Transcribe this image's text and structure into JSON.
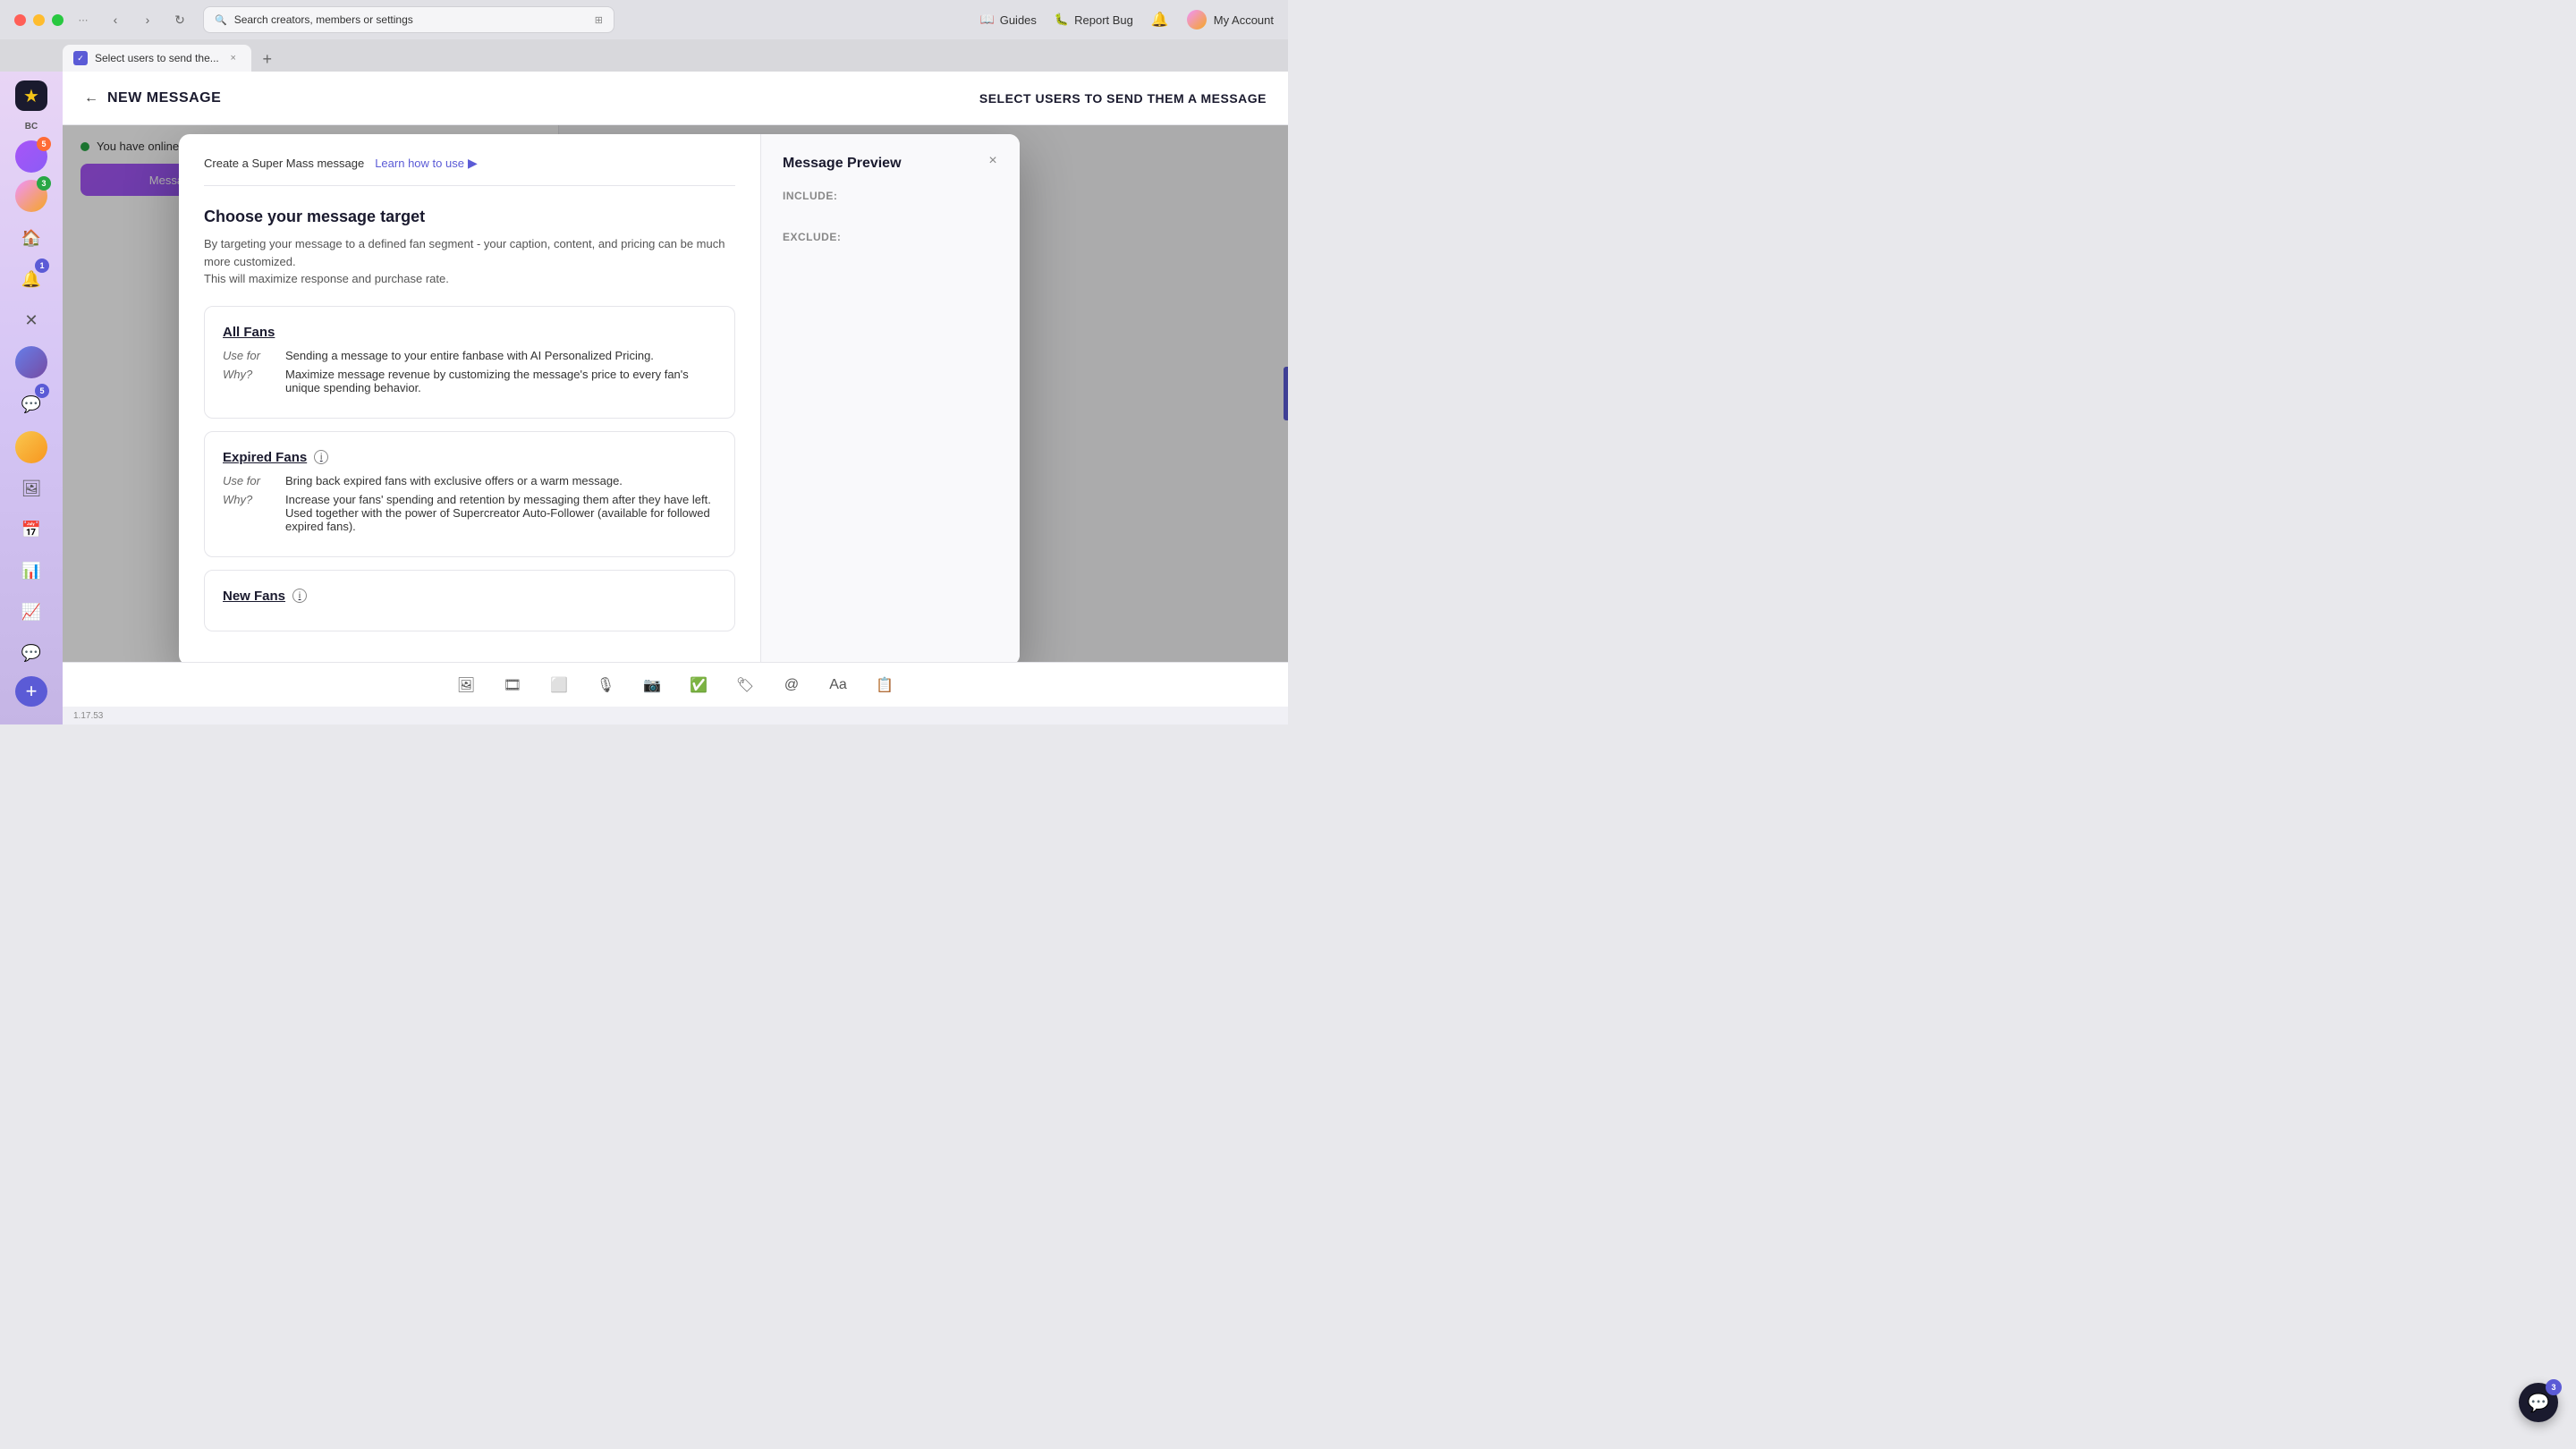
{
  "browser": {
    "search_placeholder": "Search creators, members or settings",
    "tab_title": "Select users to send the...",
    "guides_label": "Guides",
    "report_bug_label": "Report Bug",
    "my_account_label": "My Account"
  },
  "page": {
    "back_label": "←",
    "title": "NEW MESSAGE",
    "subtitle": "SELECT USERS TO SEND THEM A MESSAGE"
  },
  "sidebar": {
    "logo": "★",
    "bc_label": "BC",
    "add_label": "+",
    "badge_5": "5",
    "badge_3": "3",
    "badge_1": "1"
  },
  "banner": {
    "online_text": "You have online fans. Message them now:",
    "button_label": "Message Online Fans"
  },
  "modal": {
    "header_label": "Create a Super Mass message",
    "learn_link": "Learn how to use",
    "learn_icon": "▶",
    "close_icon": "×",
    "section_title": "Choose your message target",
    "section_desc_1": "By targeting your message to a defined fan segment - your caption, content, and pricing can be much more customized.",
    "section_desc_2": "This will maximize response and purchase rate.",
    "cards": [
      {
        "title": "All Fans",
        "use_for_label": "Use for",
        "use_for_value": "Sending a message to your entire fanbase with AI Personalized Pricing.",
        "why_label": "Why?",
        "why_value": "Maximize message revenue by customizing the message's price to every fan's unique spending behavior."
      },
      {
        "title": "Expired Fans",
        "has_info": true,
        "use_for_label": "Use for",
        "use_for_value": "Bring back expired fans with exclusive offers or a warm message.",
        "why_label": "Why?",
        "why_value_1": "Increase your fans' spending and retention by messaging them after they have left.",
        "why_value_2": "Used together with the power of Supercreator Auto-Follower (available for followed expired fans)."
      },
      {
        "title": "New Fans",
        "has_info": true
      }
    ],
    "preview": {
      "title": "Message Preview",
      "include_label": "INCLUDE:",
      "exclude_label": "EXCLUDE:"
    }
  },
  "toolbar": {
    "icons": [
      "🖼",
      "🎞",
      "⬜",
      "🎙",
      "📷",
      "✅",
      "🏷",
      "@",
      "Aa",
      "📋"
    ]
  },
  "status": {
    "version": "1.17.53"
  },
  "chat_badge": "3"
}
